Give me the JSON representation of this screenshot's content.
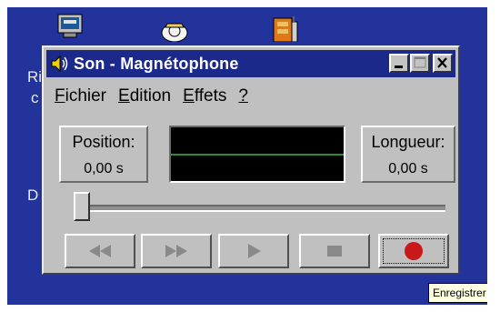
{
  "window": {
    "title": "Son - Magnétophone"
  },
  "menu": {
    "items": [
      {
        "hotkey": "F",
        "rest": "ichier"
      },
      {
        "hotkey": "E",
        "rest": "dition"
      },
      {
        "hotkey": "E",
        "rest": "ffets"
      },
      {
        "hotkey": "?",
        "rest": ""
      }
    ]
  },
  "position": {
    "label": "Position:",
    "value": "0,00 s"
  },
  "length": {
    "label": "Longueur:",
    "value": "0,00 s"
  },
  "slider": {
    "position_fraction": 0
  },
  "controls": {
    "rewind": "rewind-icon",
    "fast_forward": "fast-forward-icon",
    "play": "play-icon",
    "stop": "stop-icon",
    "record": "record-icon"
  },
  "desktop_labels": [
    "Ri",
    "c",
    "D"
  ],
  "tooltip": "Enregistrer",
  "colors": {
    "desktop": "#22339b",
    "titlebar": "#1b2a8a",
    "record": "#c81818"
  }
}
